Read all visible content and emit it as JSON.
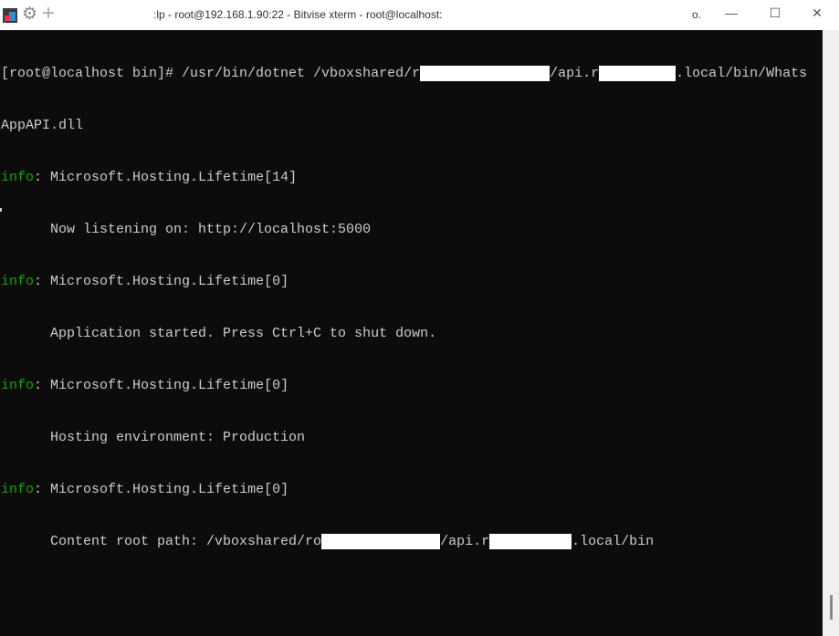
{
  "window": {
    "title": ":lp - root@192.168.1.90:22 - Bitvise xterm - root@localhost:",
    "extra": "o.",
    "minimize": "—",
    "maximize": "☐",
    "close": "✕"
  },
  "icons": {
    "app": "bitvise-app-icon",
    "settings": "gear-icon",
    "new": "plus-icon"
  },
  "colors": {
    "background": "#0c0c0c",
    "text": "#cccccc",
    "info": "#13a10e"
  },
  "terminal": {
    "line1": {
      "a": "[root@localhost bin]# /usr/bin/dotnet /vboxshared/r",
      "b": "/api.r",
      "c": ".local/bin/Whats"
    },
    "line2": "AppAPI.dll",
    "entries": [
      {
        "level": "info",
        "sep": ": ",
        "source": "Microsoft.Hosting.Lifetime[14]",
        "message": "      Now listening on: http://localhost:5000"
      },
      {
        "level": "info",
        "sep": ": ",
        "source": "Microsoft.Hosting.Lifetime[0]",
        "message": "      Application started. Press Ctrl+C to shut down."
      },
      {
        "level": "info",
        "sep": ": ",
        "source": "Microsoft.Hosting.Lifetime[0]",
        "message": "      Hosting environment: Production"
      },
      {
        "level": "info",
        "sep": ": ",
        "source": "Microsoft.Hosting.Lifetime[0]"
      }
    ],
    "content_root": {
      "a": "      Content root path: /vboxshared/ro",
      "b": "/api.r",
      "c": ".local/bin"
    }
  }
}
